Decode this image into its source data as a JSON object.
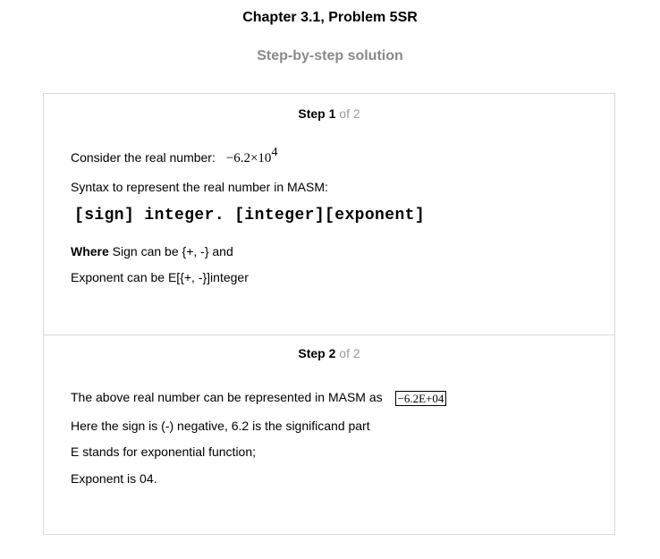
{
  "header": {
    "title": "Chapter 3.1, Problem 5SR",
    "subtitle": "Step-by-step solution"
  },
  "steps": [
    {
      "label": "Step",
      "number": "1",
      "of_text": "of 2",
      "lines": {
        "consider_label": "Consider the real number:",
        "number_mantissa": "−6.2×10",
        "number_exponent": "4",
        "syntax_intro": "Syntax to represent the real number in MASM:",
        "syntax": "[sign] integer. [integer][exponent]",
        "where_bold": "Where",
        "where_rest": " Sign can be {+, -} and",
        "exponent_rule": "Exponent can be E[{+, -}]integer"
      }
    },
    {
      "label": "Step",
      "number": "2",
      "of_text": "of 2",
      "lines": {
        "represented_text": "The above real number can be represented in MASM as",
        "answer": "−6.2E+04",
        "sign_line": "Here the sign is (-) negative, 6.2 is the significand part",
        "e_line": "E stands for exponential function;",
        "exponent_line": "Exponent is 04."
      }
    }
  ]
}
